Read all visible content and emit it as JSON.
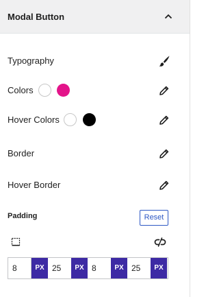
{
  "panel": {
    "title": "Modal Button"
  },
  "rows": [
    {
      "label": "Typography",
      "icon": "paintbrush-icon"
    },
    {
      "label": "Colors",
      "icon": "pencil-icon",
      "swatches": [
        "#ffffff",
        "#e3148a"
      ]
    },
    {
      "label": "Hover Colors",
      "icon": "pencil-icon",
      "swatches": [
        "#ffffff",
        "#000000"
      ]
    },
    {
      "label": "Border",
      "icon": "pencil-icon"
    },
    {
      "label": "Hover Border",
      "icon": "pencil-icon"
    }
  ],
  "padding": {
    "label": "Padding",
    "reset_label": "Reset",
    "values": [
      {
        "value": "8",
        "unit": "PX"
      },
      {
        "value": "25",
        "unit": "PX"
      },
      {
        "value": "8",
        "unit": "PX"
      },
      {
        "value": "25",
        "unit": "PX"
      }
    ]
  },
  "colors": {
    "accent": "#3d2aa4",
    "reset": "#2d58c4",
    "header_bg": "#f0f0f1",
    "pink_swatch": "#e3148a"
  }
}
